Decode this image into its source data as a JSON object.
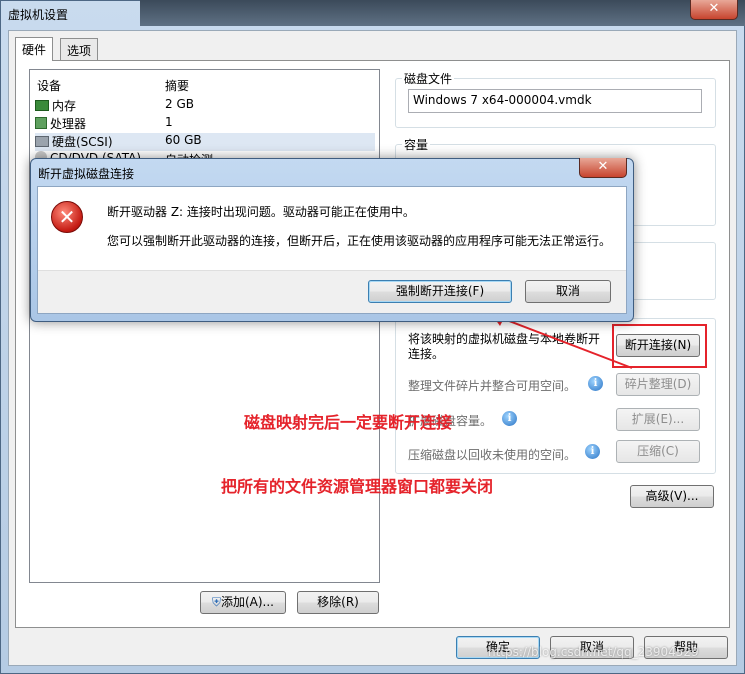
{
  "window": {
    "title": "虚拟机设置",
    "close": "✕"
  },
  "tabs": [
    "硬件",
    "选项"
  ],
  "device_table": {
    "headers": [
      "设备",
      "摘要"
    ],
    "rows": [
      {
        "device": "内存",
        "summary": "2 GB",
        "icon": "memory-icon"
      },
      {
        "device": "处理器",
        "summary": "1",
        "icon": "processor-icon"
      },
      {
        "device": "硬盘(SCSI)",
        "summary": "60 GB",
        "icon": "harddisk-icon"
      },
      {
        "device": "CD/DVD (SATA)",
        "summary": "自动检测",
        "icon": "cdrom-icon"
      }
    ]
  },
  "left_buttons": {
    "add": "添加(A)...",
    "remove": "移除(R)"
  },
  "disk_file": {
    "title": "磁盘文件",
    "value": "Windows 7 x64-000004.vmdk"
  },
  "capacity": {
    "title": "容量"
  },
  "mapping": {
    "disconnect_text": "将该映射的虚拟机磁盘与本地卷断开连接。",
    "disconnect_button": "断开连接(N)",
    "defrag_text": "整理文件碎片并整合可用空间。",
    "defrag_button": "碎片整理(D)",
    "expand_text": "扩展磁盘容量。",
    "expand_button": "扩展(E)...",
    "compact_text": "压缩磁盘以回收未使用的空间。",
    "compact_button": "压缩(C)",
    "advanced_button": "高级(V)..."
  },
  "footer": {
    "ok": "确定",
    "cancel": "取消",
    "help": "帮助"
  },
  "dialog": {
    "title": "断开虚拟磁盘连接",
    "close": "✕",
    "message1": "断开驱动器 Z: 连接时出现问题。驱动器可能正在使用中。",
    "message2": "您可以强制断开此驱动器的连接，但断开后，正在使用该驱动器的应用程序可能无法正常运行。",
    "force_button": "强制断开连接(F)",
    "cancel_button": "取消"
  },
  "annotations": {
    "note1": "磁盘映射完后一定要断开连接",
    "note2": "把所有的文件资源管理器窗口都要关闭"
  },
  "watermark": "https://blog.csdn.net/qq_23904529",
  "colors": {
    "accent_red": "#e5232b",
    "error_red": "#c41a12",
    "selection": "#dde7f3"
  }
}
